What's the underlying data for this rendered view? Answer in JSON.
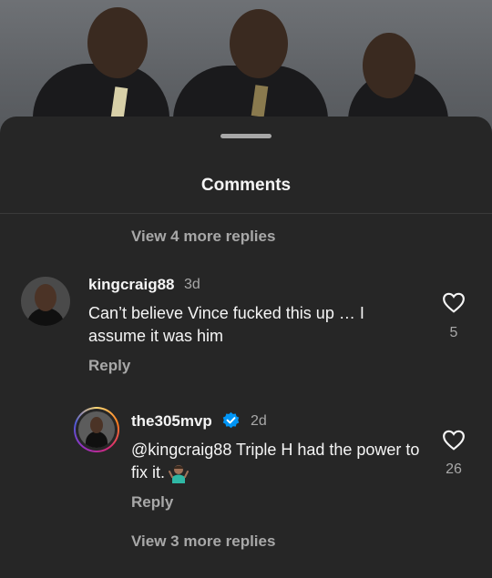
{
  "header": {
    "title": "Comments"
  },
  "thread": {
    "top_view_more": "View 4 more replies",
    "bottom_view_more": "View 3 more replies"
  },
  "comments": [
    {
      "username": "kingcraig88",
      "time": "3d",
      "text": "Can’t believe Vince fucked this up … I assume it was him",
      "reply_label": "Reply",
      "likes": "5",
      "avatar_icon": "profile-photo"
    },
    {
      "username": "the305mvp",
      "verified": true,
      "time": "2d",
      "text": "@kingcraig88 Triple H had the power to fix it.",
      "emoji_icon": "person-shrugging-emoji",
      "reply_label": "Reply",
      "likes": "26",
      "avatar_icon": "profile-photo-with-story-ring"
    }
  ],
  "colors": {
    "background": "#262626",
    "secondary_text": "#a8a8a8",
    "verified_blue": "#0095f6"
  }
}
